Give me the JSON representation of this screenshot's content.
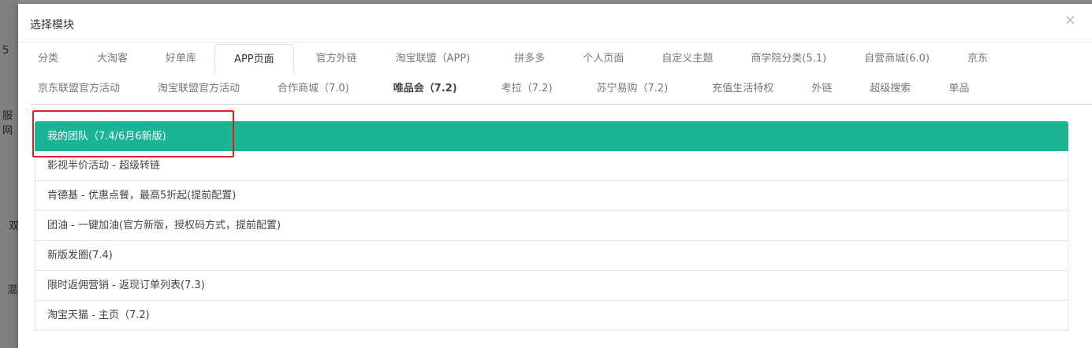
{
  "background": {
    "fragments": [
      "5",
      "服网",
      "双",
      "混"
    ]
  },
  "dialog": {
    "title": "选择模块",
    "close_label": "×"
  },
  "tabs_row1": [
    "分类",
    "大淘客",
    "好单库",
    "APP页面",
    "官方外链",
    "淘宝联盟（APP)",
    "拼多多",
    "个人页面",
    "自定义主题",
    "商学院分类(5.1)",
    "自营商城(6.0)",
    "京东"
  ],
  "tabs_row2": [
    "京东联盟官方活动",
    "淘宝联盟官方活动",
    "合作商城（7.0)",
    "唯品会（7.2)",
    "考拉（7.2)",
    "苏宁易购（7.2)",
    "充值生活特权",
    "外链",
    "超级搜索",
    "单品"
  ],
  "active_tab": "APP页面",
  "modules": [
    "我的团队（7.4/6月6新版)",
    "影视半价活动 - 超级转链",
    "肯德基 - 优惠点餐，最高5折起(提前配置)",
    "团油 - 一键加油(官方新版，授权码方式，提前配置)",
    "新版发圈(7.4)",
    "限时返佣营销 - 返现订单列表(7.3)",
    "淘宝天猫 - 主页（7.2)"
  ],
  "colors": {
    "accent": "#1ab394",
    "annotation": "#e02020"
  }
}
